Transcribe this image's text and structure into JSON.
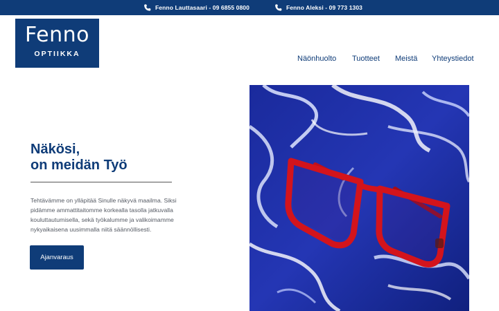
{
  "topbar": {
    "contacts": [
      {
        "label": "Fenno Lauttasaari - 09 6855 0800",
        "icon": "phone-icon"
      },
      {
        "label": "Fenno Aleksi - 09 773 1303",
        "icon": "phone-icon"
      }
    ]
  },
  "logo": {
    "name": "Fenno",
    "sub": "OPTIIKKA"
  },
  "nav": {
    "items": [
      {
        "label": "Näönhuolto"
      },
      {
        "label": "Tuotteet"
      },
      {
        "label": "Meistä"
      },
      {
        "label": "Yhteystiedot"
      }
    ]
  },
  "hero": {
    "title_line1": "Näkösi,",
    "title_line2": "on meidän Työ",
    "text": "Tehtävämme on ylläpitää Sinulle näkyvä maailma. Siksi pidämme ammattitaitomme korkealla tasolla jatkuvalla kouluttautumisella, sekä työkalumme ja valikoimamme nykyaikaisena uusimmalla niitä säännöllisesti.",
    "cta_label": "Ajanvaraus"
  },
  "colors": {
    "brand": "#0f3c78",
    "image_blue": "#1f2fa6",
    "frame_red": "#d3141c"
  }
}
